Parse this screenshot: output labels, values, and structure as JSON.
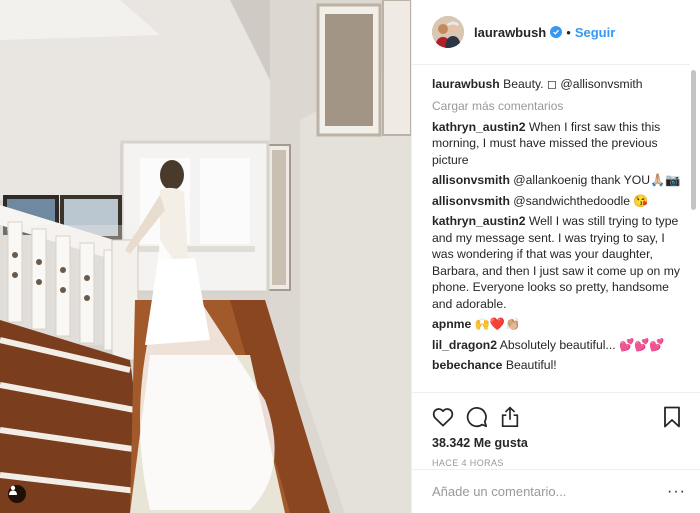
{
  "post": {
    "author": "laurawbush",
    "follow_label": "Seguir",
    "caption_user": "laurawbush",
    "caption_text": "Beauty. ◻ @allisonvsmith",
    "load_more": "Cargar más comentarios",
    "comments": [
      {
        "user": "kathryn_austin2",
        "text": "When I first saw this this morning, I must have missed the previous picture"
      },
      {
        "user": "allisonvsmith",
        "text": "@allankoenig thank YOU🙏🏼📷"
      },
      {
        "user": "allisonvsmith",
        "text": "@sandwichthedoodle 😘"
      },
      {
        "user": "kathryn_austin2",
        "text": "Well I was still trying to type and my message sent. I was trying to say, I was wondering if that was your daughter, Barbara, and then I just saw it come up on my phone. Everyone looks so pretty, handsome and adorable."
      },
      {
        "user": "apnme",
        "text": "🙌❤️👏🏼"
      },
      {
        "user": "lil_dragon2",
        "text": "Absolutely beautiful... 💕💕💕"
      },
      {
        "user": "bebechance",
        "text": "Beautiful!"
      }
    ],
    "likes": "38.342 Me gusta",
    "timestamp": "HACE 4 HORAS",
    "comment_placeholder": "Añade un comentario...",
    "more_options": "···"
  },
  "icons": {
    "like": "heart-icon",
    "comment": "comment-icon",
    "share": "share-icon",
    "save": "bookmark-icon",
    "verified": "verified-badge-icon",
    "tag": "user-tag-icon"
  },
  "colors": {
    "link_blue": "#3897f0",
    "muted_gray": "#999999",
    "text": "#262626",
    "border": "#efefef"
  }
}
